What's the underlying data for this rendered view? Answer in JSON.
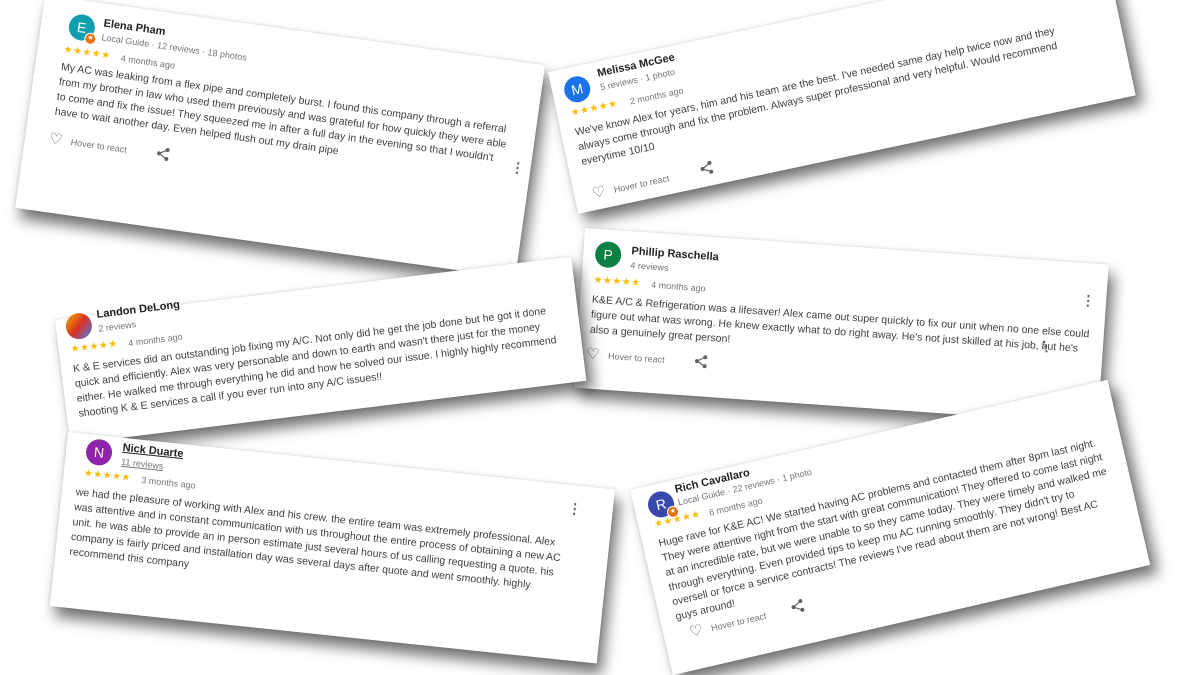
{
  "common": {
    "stars": "★★★★★",
    "hover_to_react": "Hover to react",
    "more": "⋮",
    "heart": "♡",
    "badge": "★"
  },
  "reviews": [
    {
      "initial": "E",
      "avatar_color": "#129eaf",
      "name": "Elena Pham",
      "meta": "Local Guide · 12 reviews · 18 photos",
      "ago": "4 months ago",
      "text": "My AC was leaking from a flex pipe and completely burst. I found this company through a referral from my brother in law who used them previously and was grateful for how quickly they were able to come and fix the issue! They squeezed me in after a full day in the evening so that I wouldn't have to wait another day. Even helped flush out my drain pipe"
    },
    {
      "initial": "M",
      "avatar_color": "#1a73e8",
      "name": "Melissa McGee",
      "meta": "5 reviews · 1 photo",
      "ago": "2 months ago",
      "text": "We've know Alex for years, him and his team are the best. I've needed same day help twice now and they always come through and fix the problem. Always super professional and very helpful. Would recommend everytime 10/10"
    },
    {
      "initial": "P",
      "avatar_color": "#0b8043",
      "name": "Phillip Raschella",
      "meta": "4 reviews",
      "ago": "4 months ago",
      "text": "K&E A/C & Refrigeration was a lifesaver! Alex came out super quickly to fix our unit when no one else could figure out what was wrong. He knew exactly what to do right away. He's not just skilled at his job, but he's also a genuinely great person!"
    },
    {
      "initial": "",
      "avatar_color": "#d93025",
      "name": "Landon DeLong",
      "meta": "2 reviews",
      "ago": "4 months ago",
      "text": "K & E services did an outstanding job fixing my A/C. Not only did he get the job done but he got it done quick and efficiently. Alex was very personable and down to earth and wasn't there just for the money either. He walked me through everything he did and how he solved our issue. I highly highly recommend shooting K & E services a call if you ever run into any A/C issues!!"
    },
    {
      "initial": "N",
      "avatar_color": "#8e24aa",
      "name": "Nick Duarte",
      "meta": "11 reviews",
      "ago": "3 months ago",
      "text": "we had the pleasure of working with Alex and his crew. the entire team was extremely professional. Alex was attentive and in constant communication with us throughout the entire process of obtaining a new AC unit. he was able to provide an in person estimate just several hours of us calling requesting a quote. his company is fairly priced and installation day was several days after quote and went smoothly. highly recommend this company"
    },
    {
      "initial": "R",
      "avatar_color": "#3949ab",
      "name": "Rich Cavallaro",
      "meta": "Local Guide · 22 reviews · 1 photo",
      "ago": "6 months ago",
      "text": "Huge rave for K&E AC! We started having AC problems and contacted them after 8pm last night. They were attentive right from the start with great communication! They offered to come last night at an incredible rate, but we were unable to so they came today. They were timely and walked me through everything. Even provided tips to keep mu AC running smoothly. They didn't try to oversell or force a service contracts! The reviews I've read about them are not wrong! Best AC guys around!"
    }
  ]
}
